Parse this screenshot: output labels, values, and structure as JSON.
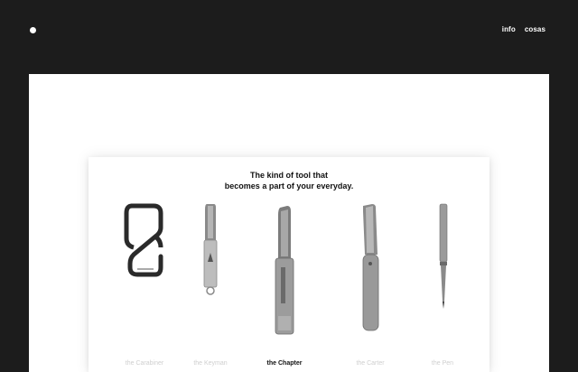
{
  "header": {
    "nav": [
      {
        "label": "info"
      },
      {
        "label": "cosas"
      }
    ]
  },
  "hero": {
    "headline_line1": "The kind of tool that",
    "headline_line2": "becomes a part of your everyday."
  },
  "products": [
    {
      "icon": "carabiner-icon",
      "label": "the Carabiner"
    },
    {
      "icon": "pocket-knife-icon",
      "label": "the Keyman"
    },
    {
      "icon": "chapter-knife-icon",
      "label": "the Chapter"
    },
    {
      "icon": "slip-joint-knife-icon",
      "label": "the Carter"
    },
    {
      "icon": "pen-icon",
      "label": "the Pen"
    }
  ],
  "active_product": "the Chapter"
}
